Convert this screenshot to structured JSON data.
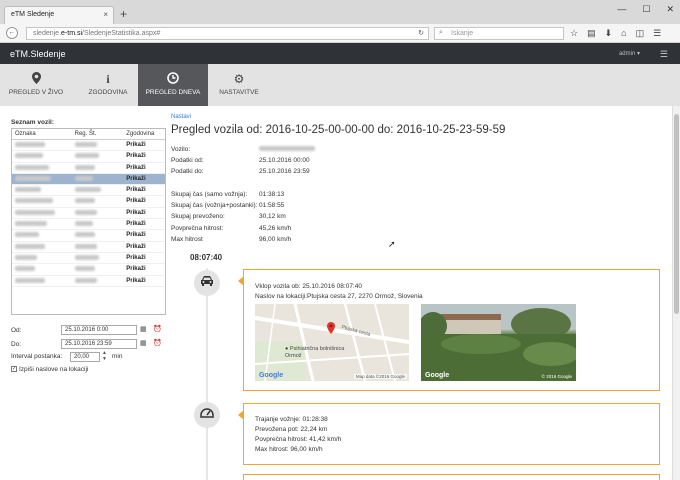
{
  "browser": {
    "tab_title": "eTM Sledenje",
    "tab_close": "×",
    "new_tab": "+",
    "url_pre": "sledenje.",
    "url_domain": "e-tm.si",
    "url_post": "/SledenjeStatistika.aspx#",
    "search_placeholder": "Iskanje"
  },
  "app": {
    "title": "eTM.Sledenje",
    "user": "admin ▾"
  },
  "menu": [
    {
      "label": "PREGLED V ŽIVO",
      "icon": "map-marker-icon"
    },
    {
      "label": "ZGODOVINA",
      "icon": "info-icon"
    },
    {
      "label": "PREGLED DNEVA",
      "icon": "clock-icon",
      "active": true
    },
    {
      "label": "NASTAVITVE",
      "icon": "gear-icon"
    }
  ],
  "vehicles": {
    "section_label": "Seznam vozil:",
    "headers": [
      "Oznaka",
      "Reg. Št.",
      "Zgodovina"
    ],
    "action_label": "Prikaži",
    "row_count": 13,
    "selected_row": 3
  },
  "form": {
    "from_label": "Od:",
    "from_value": "25.10.2016 0:00",
    "to_label": "Do:",
    "to_value": "25.10.2016 23:59",
    "interval_label": "Interval postanka:",
    "interval_value": "20,00",
    "interval_unit": "min",
    "checkbox_label": "Izpiši naslove na lokaciji",
    "checkbox_checked": true
  },
  "main": {
    "breadcrumb": "Nastavi",
    "title": "Pregled vozila od: 2016-10-25-00-00-00 do: 2016-10-25-23-59-59",
    "vehicle_label": "Vozilo:",
    "from_label": "Podatki od:",
    "from_value": "25.10.2016 00:00",
    "to_label": "Podatki do:",
    "to_value": "25.10.2016 23:59",
    "stats": [
      {
        "label": "Skupaj čas (samo vožnja):",
        "value": "01:38:13"
      },
      {
        "label": "Skupaj čas (vožnja+postanki):",
        "value": "01:58:55"
      },
      {
        "label": "Skupaj prevoženo:",
        "value": "30,12 km"
      },
      {
        "label": "Povprečna hitrost:",
        "value": "45,26 km/h"
      },
      {
        "label": "Max hitrost",
        "value": "96,00 km/h"
      }
    ]
  },
  "timeline": {
    "time": "08:07:40",
    "event1": {
      "line1": "Vklop vozila ob: 25.10.2016 08:07:40",
      "line2": "Naslov na lokaciji:Ptujska cesta 27, 2270 Ormož, Slovenia",
      "map_label": "Psihiatrična bolnišnica Ormož",
      "map_street": "Ptujska cesta",
      "map_credit": "Map data ©2016 Google",
      "photo_credit": "© 2016 Google",
      "google": "Google"
    },
    "event2": {
      "lines": [
        "Trajanje vožnje: 01:28:38",
        "Prevožena pot: 22,24 km",
        "Povprečna hitrost: 41,42 km/h",
        "Max hitrost: 96,00 km/h"
      ]
    }
  }
}
